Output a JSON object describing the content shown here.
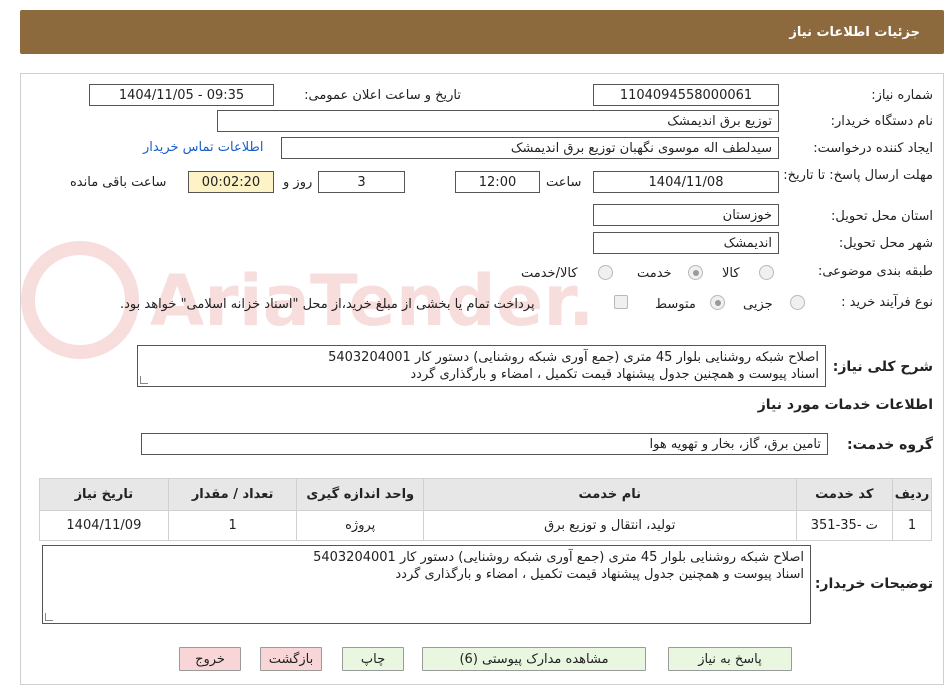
{
  "header": {
    "title": "جزئیات اطلاعات نیاز"
  },
  "form": {
    "need_number": {
      "label": "شماره نیاز:",
      "value": "1104094558000061"
    },
    "announce": {
      "label": "تاریخ و ساعت اعلان عمومی:",
      "value": "1404/11/05 - 09:35"
    },
    "buyer_org": {
      "label": "نام دستگاه خریدار:",
      "value": "توزیع برق اندیمشک"
    },
    "requester": {
      "label": "ایجاد کننده درخواست:",
      "value": "سیدلطف اله موسوی نگهبان توزیع برق اندیمشک",
      "contact_link": "اطلاعات تماس خریدار"
    },
    "deadline": {
      "label": "مهلت ارسال پاسخ: تا تاریخ:",
      "date": "1404/11/08",
      "time_label": "ساعت",
      "time": "12:00",
      "days": "3",
      "days_label": "روز و",
      "remaining": "00:02:20",
      "remaining_label": "ساعت باقی مانده"
    },
    "province": {
      "label": "استان محل تحویل:",
      "value": "خوزستان"
    },
    "city": {
      "label": "شهر محل تحویل:",
      "value": "اندیمشک"
    },
    "category": {
      "label": "طبقه بندی موضوعی:",
      "options": [
        "کالا",
        "خدمت",
        "کالا/خدمت"
      ],
      "selected": "خدمت"
    },
    "process": {
      "label": "نوع فرآیند خرید :",
      "options": [
        "جزیی",
        "متوسط"
      ],
      "selected": "متوسط",
      "treasury_note": "پرداخت تمام یا بخشی از مبلغ خرید،از محل \"اسناد خزانه اسلامی\" خواهد بود."
    },
    "description": {
      "label": "شرح کلی نیاز:",
      "value": "اصلاح شبکه روشنایی بلوار 45 متری (جمع آوری شبکه روشنایی) دستور کار  5403204001\nاسناد پیوست و همچنین جدول پیشنهاد قیمت تکمیل ، امضاء  و بارگذاری گردد"
    }
  },
  "services": {
    "section_title": "اطلاعات خدمات مورد نیاز",
    "group_label": "گروه خدمت:",
    "group_value": "تامین برق، گاز، بخار و تهویه هوا",
    "table": {
      "headers": [
        "ردیف",
        "کد خدمت",
        "نام خدمت",
        "واحد اندازه گیری",
        "تعداد / مقدار",
        "تاریخ نیاز"
      ],
      "rows": [
        [
          "1",
          "ت -35-351",
          "تولید، انتقال و توزیع برق",
          "پروژه",
          "1",
          "1404/11/09"
        ]
      ]
    }
  },
  "buyer_notes": {
    "label": "توضیحات خریدار:",
    "value": "اصلاح شبکه روشنایی بلوار 45 متری (جمع آوری شبکه روشنایی) دستور کار  5403204001\nاسناد پیوست و همچنین جدول پیشنهاد قیمت تکمیل ، امضاء  و بارگذاری گردد"
  },
  "buttons": {
    "reply": "پاسخ به نیاز",
    "attachments": "مشاهده مدارک پیوستی (6)",
    "print": "چاپ",
    "back": "بازگشت",
    "exit": "خروج"
  },
  "watermark": {
    "text": "AriaTender.neT"
  },
  "colors": {
    "header_bg": "#8c6a3e",
    "button_green": "#e9f7e0",
    "button_red": "#f8d6d8",
    "link": "#1a5ec9",
    "timer_bg": "#fdf3c6"
  }
}
